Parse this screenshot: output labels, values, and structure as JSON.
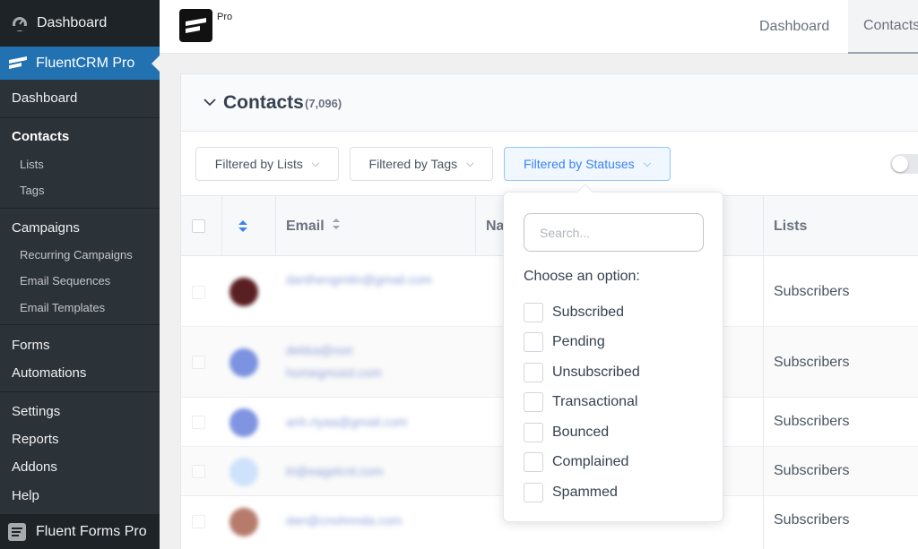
{
  "wp_menu": {
    "top_label": "Dashboard",
    "active_plugin": "FluentCRM Pro",
    "submenu": [
      {
        "label": "Dashboard",
        "level": 1
      },
      {
        "label": "Contacts",
        "level": 1,
        "current": true
      },
      {
        "label": "Lists",
        "level": 2
      },
      {
        "label": "Tags",
        "level": 2
      },
      {
        "label": "Campaigns",
        "level": 1
      },
      {
        "label": "Recurring Campaigns",
        "level": 2
      },
      {
        "label": "Email Sequences",
        "level": 2
      },
      {
        "label": "Email Templates",
        "level": 2
      },
      {
        "label": "Forms",
        "level": 1
      },
      {
        "label": "Automations",
        "level": 1
      },
      {
        "label": "Settings",
        "level": 1
      },
      {
        "label": "Reports",
        "level": 1
      },
      {
        "label": "Addons",
        "level": 1
      },
      {
        "label": "Help",
        "level": 1
      }
    ],
    "bottom_plugin": "Fluent Forms Pro"
  },
  "topbar": {
    "logo_badge": "Pro",
    "nav": [
      "Dashboard",
      "Contacts"
    ]
  },
  "contacts": {
    "title": "Contacts",
    "count": "(7,096)"
  },
  "filters": {
    "lists": "Filtered by Lists",
    "tags": "Filtered by Tags",
    "statuses": "Filtered by Statuses"
  },
  "table": {
    "columns": {
      "email": "Email",
      "name": "Na",
      "lists": "Lists"
    },
    "rows": [
      {
        "email": [
          "danthengmitn@gmail.com"
        ],
        "list": "Subscribers",
        "avatar_color": "#5a1f22"
      },
      {
        "email": [
          "dekka@non",
          "homegmoiol.com"
        ],
        "list": "Subscribers",
        "avatar_color": "#7b93e0"
      },
      {
        "email": [
          "anh.riyaa@gmail.com"
        ],
        "list": "Subscribers",
        "avatar_color": "#8094e2"
      },
      {
        "email": [
          "lri@eagelcnt.com"
        ],
        "list": "Subscribers",
        "avatar_color": "#cfe2fb"
      },
      {
        "email": [
          "dan@cnohnnda.com"
        ],
        "list": "Subscribers",
        "avatar_color": "#b77b6c"
      }
    ]
  },
  "status_dropdown": {
    "search_placeholder": "Search...",
    "heading": "Choose an option:",
    "options": [
      "Subscribed",
      "Pending",
      "Unsubscribed",
      "Transactional",
      "Bounced",
      "Complained",
      "Spammed"
    ]
  },
  "colors": {
    "wp_sidebar": "#1d2327",
    "wp_active": "#2271b1",
    "filter_active": "#3b82f6"
  }
}
